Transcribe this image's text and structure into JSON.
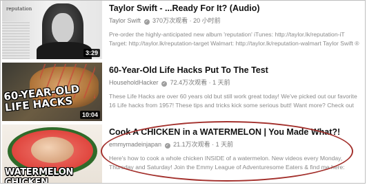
{
  "results": [
    {
      "title": "Taylor Swift - ...Ready For It? (Audio)",
      "channel": "Taylor Swift",
      "views": "370万次观看",
      "age": "20 小时前",
      "duration": "3:29",
      "description": "Pre-order the highly-anticipated new album 'reputation' iTunes: http://taylor.lk/reputation-iT Target: http://taylor.lk/reputation-target Walmart: http://taylor.lk/reputation-walmart Taylor Swift ®",
      "thumbnail_text": "reputation"
    },
    {
      "title": "60-Year-Old Life Hacks Put To The Test",
      "channel": "HouseholdHacker",
      "views": "72.4万次观看",
      "age": "1 天前",
      "duration": "10:04",
      "description": "These Life Hacks are over 60 years old but still work great today! We've picked out our favorite 16 Life hacks from 1957! These tips and tricks kick some serious butt! Want more? Check out Life Hack.",
      "thumbnail_text": "60-YEAR-OLD LIFE HACKS"
    },
    {
      "title": "Cook A CHICKEN in a WATERMELON | You Made What?!",
      "channel": "emmymadeinjapan",
      "views": "21.1万次观看",
      "age": "1 天前",
      "duration": "",
      "description": "Here's how to cook a whole chicken INSIDE of a watermelon. New videos every Monday, Thursday and Saturday! Join the Emmy League of Adventuresome Eaters & find me here: Subscribe: http://youtub...",
      "thumbnail_text": "WATERMELON CHICKEN"
    }
  ],
  "colors": {
    "highlight": "#a3302c",
    "title": "#111111",
    "meta": "#7a7a7a"
  },
  "icons": {
    "verified": "check-circle-icon"
  }
}
